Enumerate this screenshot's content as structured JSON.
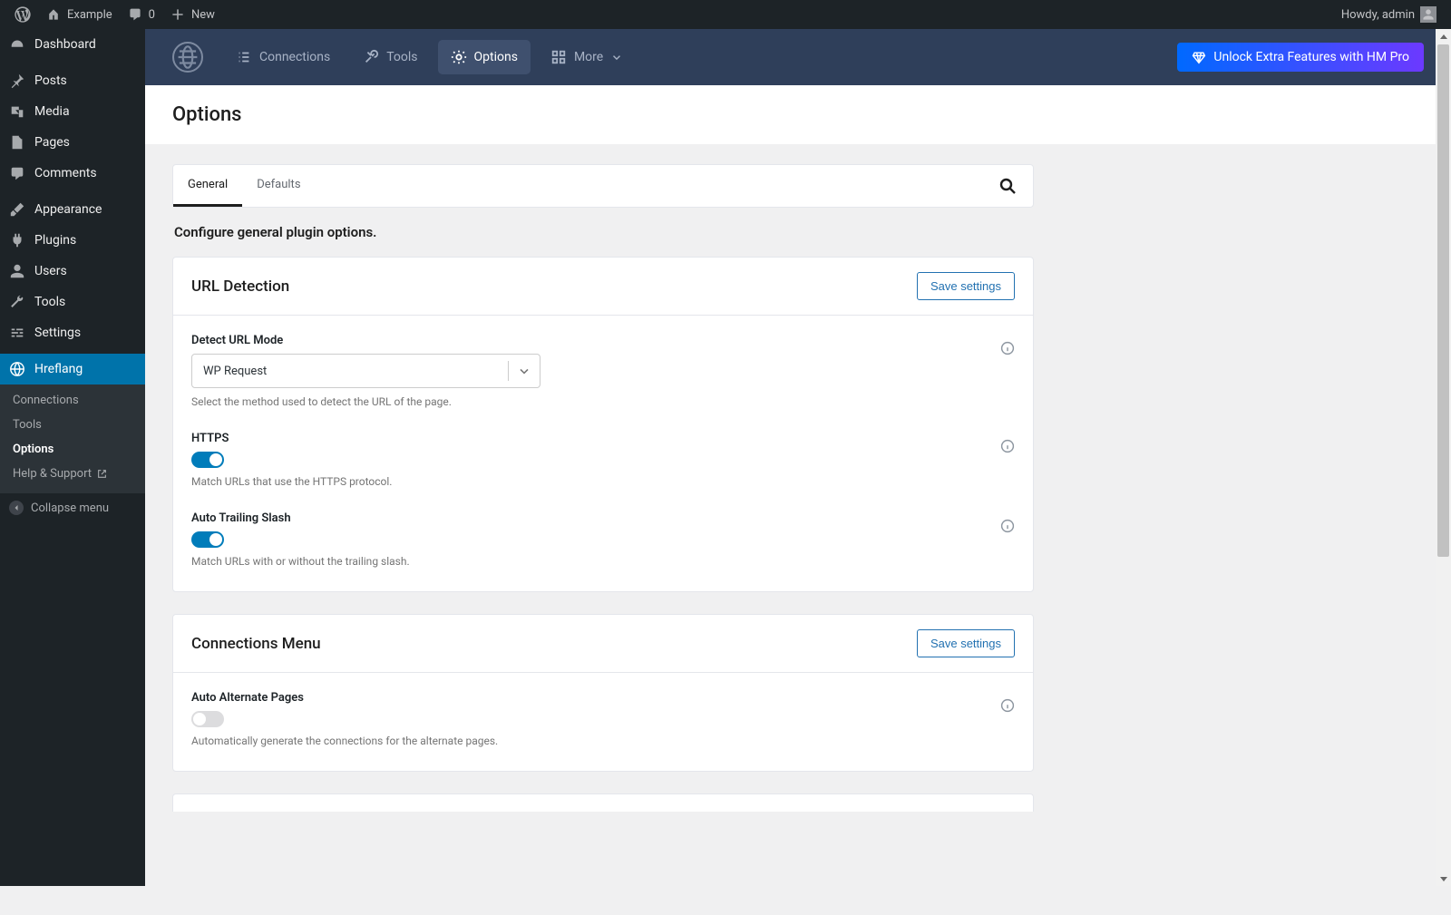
{
  "adminbar": {
    "site": "Example",
    "comments": "0",
    "new": "New",
    "howdy": "Howdy, admin"
  },
  "sidebar": {
    "items": [
      {
        "label": "Dashboard"
      },
      {
        "label": "Posts"
      },
      {
        "label": "Media"
      },
      {
        "label": "Pages"
      },
      {
        "label": "Comments"
      },
      {
        "label": "Appearance"
      },
      {
        "label": "Plugins"
      },
      {
        "label": "Users"
      },
      {
        "label": "Tools"
      },
      {
        "label": "Settings"
      },
      {
        "label": "Hreflang"
      }
    ],
    "submenu": [
      {
        "label": "Connections"
      },
      {
        "label": "Tools"
      },
      {
        "label": "Options"
      },
      {
        "label": "Help & Support"
      }
    ],
    "collapse": "Collapse menu"
  },
  "topbar": {
    "nav": [
      {
        "label": "Connections"
      },
      {
        "label": "Tools"
      },
      {
        "label": "Options"
      },
      {
        "label": "More"
      }
    ],
    "pro": "Unlock Extra Features with HM Pro"
  },
  "page": {
    "title": "Options",
    "tabs": [
      "General",
      "Defaults"
    ],
    "desc": "Configure general plugin options.",
    "save": "Save settings"
  },
  "card1": {
    "title": "URL Detection",
    "field1": {
      "label": "Detect URL Mode",
      "value": "WP Request",
      "help": "Select the method used to detect the URL of the page."
    },
    "field2": {
      "label": "HTTPS",
      "help": "Match URLs that use the HTTPS protocol."
    },
    "field3": {
      "label": "Auto Trailing Slash",
      "help": "Match URLs with or without the trailing slash."
    }
  },
  "card2": {
    "title": "Connections Menu",
    "field1": {
      "label": "Auto Alternate Pages",
      "help": "Automatically generate the connections for the alternate pages."
    }
  }
}
